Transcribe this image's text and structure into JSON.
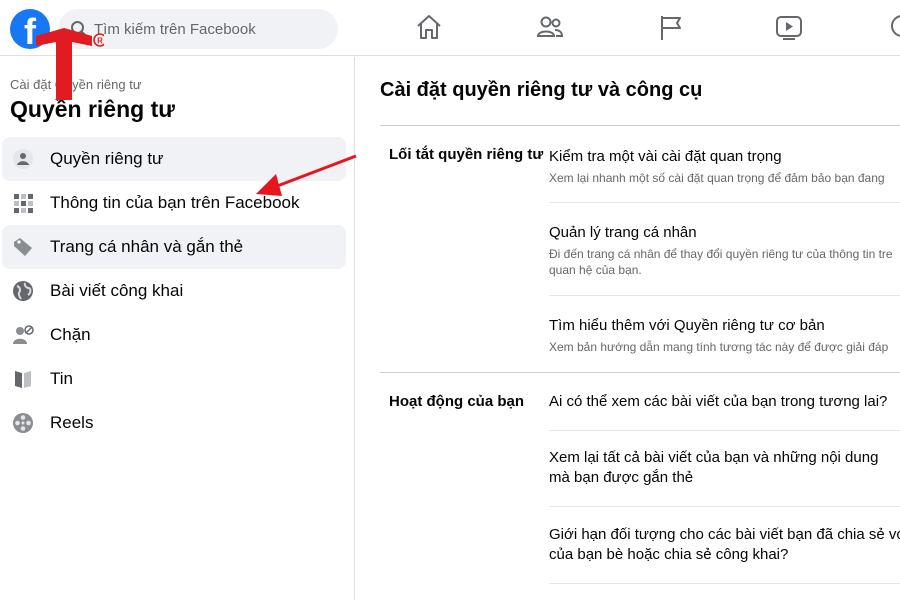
{
  "search": {
    "placeholder": "Tìm kiếm trên Facebook"
  },
  "logo": {
    "letter": "f"
  },
  "nav": [
    {
      "name": "home-icon"
    },
    {
      "name": "friends-icon"
    },
    {
      "name": "pages-flag-icon"
    },
    {
      "name": "watch-icon"
    }
  ],
  "sidebar": {
    "breadcrumb": "Cài đặt  Quyền riêng tư",
    "title": "Quyền riêng tư",
    "items": [
      {
        "label": "Quyền riêng tư",
        "icon": "lock-icon",
        "active": true
      },
      {
        "label": "Thông tin của bạn trên Facebook",
        "icon": "grid-icon",
        "active": false
      },
      {
        "label": "Trang cá nhân và gắn thẻ",
        "icon": "tag-icon",
        "active": true
      },
      {
        "label": "Bài viết công khai",
        "icon": "globe-icon",
        "active": false
      },
      {
        "label": "Chặn",
        "icon": "block-user-icon",
        "active": false
      },
      {
        "label": "Tin",
        "icon": "story-book-icon",
        "active": false
      },
      {
        "label": "Reels",
        "icon": "reels-film-icon",
        "active": false
      }
    ]
  },
  "main": {
    "title": "Cài đặt quyền riêng tư và công cụ",
    "sections": [
      {
        "label": "Lối tắt quyền riêng tư",
        "rows": [
          {
            "title": "Kiểm tra một vài cài đặt quan trọng",
            "desc": "Xem lại nhanh một số cài đặt quan trọng để đảm bảo bạn đang"
          },
          {
            "title": "Quản lý trang cá nhân",
            "desc": "Đi đến trang cá nhân để thay đổi quyền riêng tư của thông tin tre",
            "desc2": "quan hệ của bạn."
          },
          {
            "title": "Tìm hiểu thêm với Quyền riêng tư cơ bản",
            "desc": "Xem bản hướng dẫn mang tính tương tác này để được giải đáp"
          }
        ]
      },
      {
        "label": "Hoạt động của bạn",
        "rows": [
          {
            "title": "Ai có thể xem các bài viết của bạn trong tương lai?"
          },
          {
            "title": "Xem lại tất cả bài viết của bạn và những nội dung",
            "title2": "mà bạn được gắn thẻ"
          },
          {
            "title": "Giới hạn đối tượng cho các bài viết bạn đã chia sẻ vớ",
            "title2": "của bạn bè hoặc chia sẻ công khai?"
          }
        ]
      }
    ]
  },
  "colors": {
    "brand": "#1877f2",
    "arrow": "#e8141e",
    "watermark": "#e01b22"
  }
}
